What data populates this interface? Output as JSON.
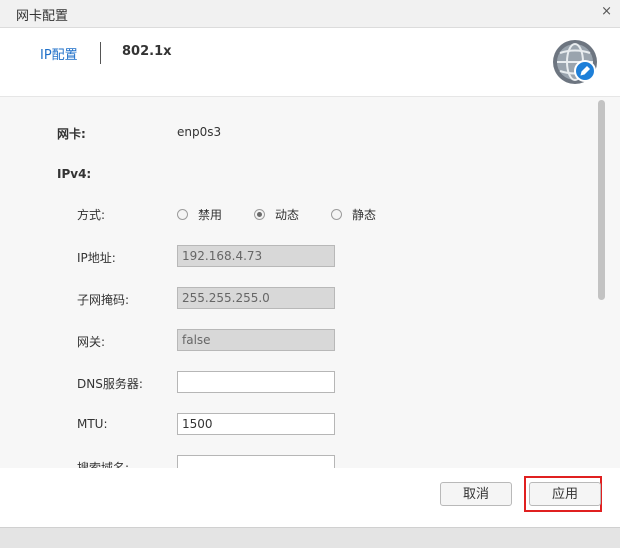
{
  "window": {
    "title": "网卡配置",
    "close": "×"
  },
  "tabs": [
    {
      "label": "IP配置"
    },
    {
      "label": "802.1x"
    }
  ],
  "form": {
    "nic_label": "网卡:",
    "nic_value": "enp0s3",
    "ipv4_label": "IPv4:",
    "method_label": "方式:",
    "method_options": [
      "禁用",
      "动态",
      "静态"
    ],
    "method_selected": "动态",
    "ip_label": "IP地址:",
    "ip_value": "192.168.4.73",
    "mask_label": "子网掩码:",
    "mask_value": "255.255.255.0",
    "gateway_label": "网关:",
    "gateway_value": "false",
    "dns_label": "DNS服务器:",
    "dns_value": "",
    "mtu_label": "MTU:",
    "mtu_value": "1500",
    "search_label": "搜索域名:",
    "search_value": ""
  },
  "footer": {
    "cancel_label": "取消",
    "apply_label": "应用"
  },
  "colors": {
    "accent": "#1e6fc8",
    "highlight": "#e02020"
  },
  "icons": {
    "avatar": "globe-edit-icon",
    "close": "close-icon"
  }
}
